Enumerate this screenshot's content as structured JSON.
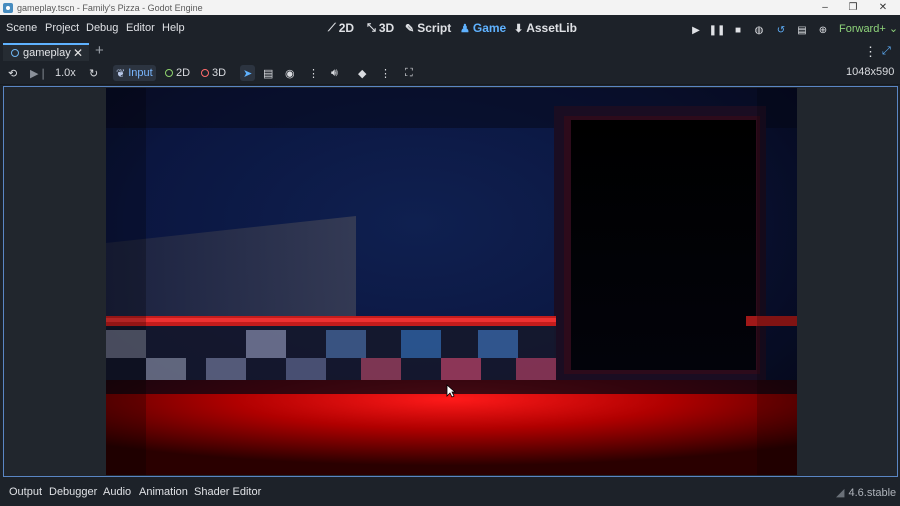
{
  "window": {
    "title": "gameplay.tscn - Family's Pizza - Godot Engine",
    "controls": {
      "minimize": "–",
      "maximize": "❐",
      "close": "✕"
    }
  },
  "menu": {
    "scene": "Scene",
    "project": "Project",
    "debug": "Debug",
    "editor": "Editor",
    "help": "Help"
  },
  "workspaces": {
    "w2d": "2D",
    "w3d": "3D",
    "script": "Script",
    "game": "Game",
    "assetlib": "AssetLib",
    "active": "Game"
  },
  "renderer": "Forward+",
  "tabs": {
    "scene": "gameplay"
  },
  "toolbar": {
    "speed": "1.0x",
    "input": "Input",
    "mode_2d": "2D",
    "mode_3d": "3D",
    "resolution": "1048x590"
  },
  "bottom": {
    "output": "Output",
    "debugger": "Debugger",
    "audio": "Audio",
    "animation": "Animation",
    "shader_editor": "Shader Editor",
    "version": "4.6.stable"
  },
  "colors": {
    "accent": "#5fb2ff",
    "renderer": "#8ed37a",
    "editor_bg": "#1d2229",
    "mode_2d": "#8fd36e",
    "mode_3d": "#ff6b6b"
  },
  "icons": {
    "remote": "remote-icon",
    "step": "step-frame-icon",
    "reset": "reset-speed-icon",
    "select": "select-arrow-icon",
    "list": "list-icon",
    "camera": "camera-eye-icon",
    "more": "kebab-icon",
    "audio": "speaker-icon",
    "override": "camera-override-icon",
    "embed": "embed-fullscreen-icon"
  }
}
